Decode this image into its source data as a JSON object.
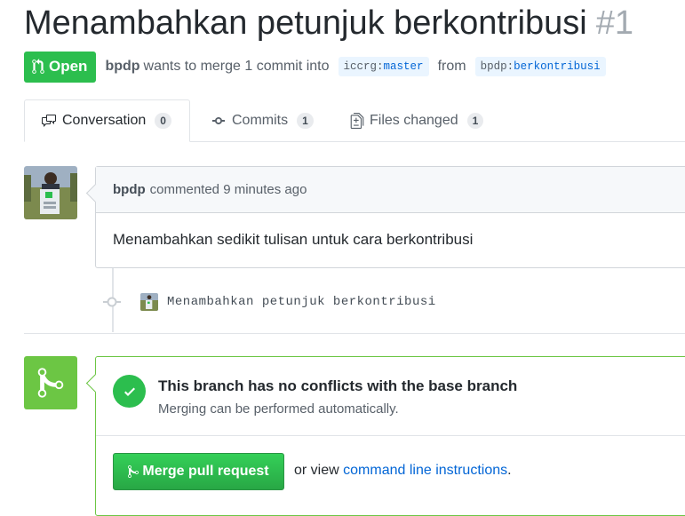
{
  "pr": {
    "title": "Menambahkan petunjuk berkontribusi",
    "number": "#1",
    "state": "Open",
    "author": "bpdp",
    "merge_text_1": "wants to merge 1 commit into",
    "base_repo": "iccrg",
    "base_branch": "master",
    "merge_text_2": "from",
    "head_repo": "bpdp",
    "head_branch": "berkontribusi",
    "ref_sep": ":"
  },
  "tabs": [
    {
      "label": "Conversation",
      "count": "0",
      "icon": "comment-discussion-icon"
    },
    {
      "label": "Commits",
      "count": "1",
      "icon": "git-commit-icon"
    },
    {
      "label": "Files changed",
      "count": "1",
      "icon": "diff-icon"
    }
  ],
  "comment": {
    "author": "bpdp",
    "action": "commented 9 minutes ago",
    "body": "Menambahkan sedikit tulisan untuk cara berkontribusi"
  },
  "commit": {
    "message": "Menambahkan petunjuk berkontribusi"
  },
  "merge": {
    "title": "This branch has no conflicts with the base branch",
    "subtitle": "Merging can be performed automatically.",
    "button": "Merge pull request",
    "alt_prefix": "or view",
    "alt_link": "command line instructions",
    "alt_suffix": "."
  },
  "colors": {
    "open_green": "#2cbe4e",
    "merge_green": "#6cc644",
    "link_blue": "#0366d6"
  }
}
